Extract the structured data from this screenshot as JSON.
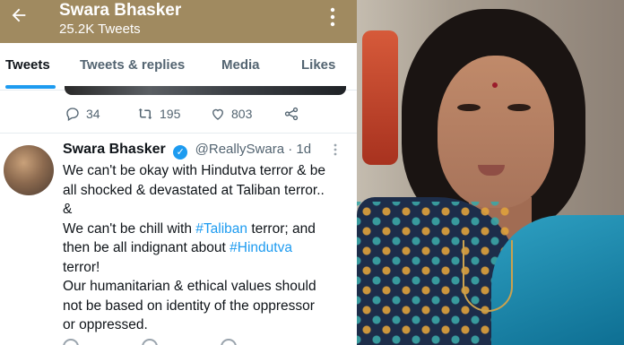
{
  "header": {
    "back_icon": "arrow-left-icon",
    "title": "Swara Bhasker",
    "subtitle": "25.2K Tweets",
    "more_icon": "more-vertical-icon",
    "color": "#a08a60"
  },
  "tabs": [
    {
      "label": "Tweets",
      "active": true
    },
    {
      "label": "Tweets & replies",
      "active": false
    },
    {
      "label": "Media",
      "active": false
    },
    {
      "label": "Likes",
      "active": false
    }
  ],
  "prev_tweet_actions": {
    "replies": "34",
    "retweets": "195",
    "likes": "803"
  },
  "tweet": {
    "name": "Swara Bhasker",
    "handle_time": "@ReallySwara · 1d",
    "lines": [
      "We can't be okay with Hindutva terror & be",
      "all shocked & devastated at Taliban terror..",
      "&",
      "We can't be chill with",
      "#Taliban",
      "terror; and",
      "then be all indignant about",
      "#Hindutva",
      "terror!",
      "Our humanitarian & ethical values should",
      "not be based on identity of the oppressor",
      "or oppressed."
    ]
  },
  "accent": "#1d9bf0"
}
